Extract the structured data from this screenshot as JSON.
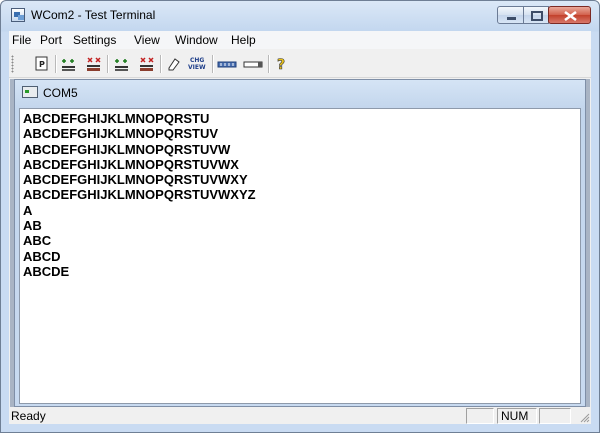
{
  "window": {
    "title": "WCom2 - Test Terminal"
  },
  "menu": {
    "items": [
      "File",
      "Port",
      "Settings",
      "View",
      "Window",
      "Help"
    ]
  },
  "toolbar": {
    "buttons": [
      "print-icon",
      "connect-icon",
      "disconnect-icon",
      "connect-all-icon",
      "disconnect-all-icon",
      "clear-icon",
      "change-view-icon",
      "hex-view-icon",
      "window-icon",
      "help-icon"
    ],
    "chg_view_label_1": "CHG",
    "chg_view_label_2": "VIEW"
  },
  "child_window": {
    "title": "COM5"
  },
  "terminal": {
    "lines": [
      "ABCDEFGHIJKLMNOPQRSTU",
      "ABCDEFGHIJKLMNOPQRSTUV",
      "ABCDEFGHIJKLMNOPQRSTUVW",
      "ABCDEFGHIJKLMNOPQRSTUVWX",
      "ABCDEFGHIJKLMNOPQRSTUVWXY",
      "ABCDEFGHIJKLMNOPQRSTUVWXYZ",
      "A",
      "AB",
      "ABC",
      "ABCD",
      "ABCDE"
    ]
  },
  "status": {
    "text": "Ready",
    "pane_1": "",
    "pane_num": "NUM",
    "pane_3": ""
  }
}
